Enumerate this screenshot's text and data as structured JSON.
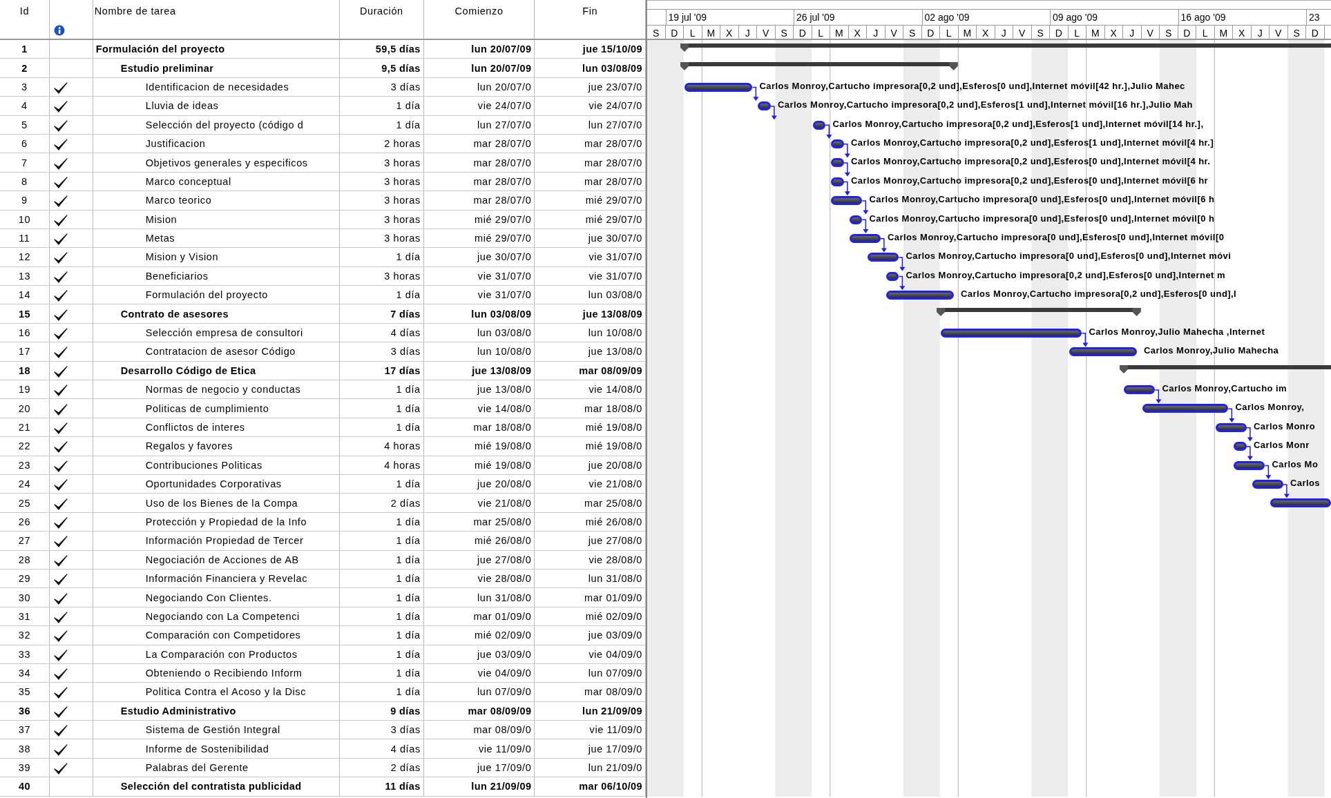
{
  "columns": {
    "id": "Id",
    "name": "Nombre de tarea",
    "duration": "Duración",
    "start": "Comienzo",
    "finish": "Fin"
  },
  "timescale": {
    "weeks": [
      "19 jul '09",
      "26 jul '09",
      "02 ago '09",
      "09 ago '09",
      "16 ago '09",
      "23"
    ],
    "days": [
      "S",
      "D",
      "L",
      "M",
      "X",
      "J",
      "V",
      "S",
      "D",
      "L",
      "M",
      "X",
      "J",
      "V",
      "S",
      "D",
      "L",
      "M",
      "X",
      "J",
      "V",
      "S",
      "D",
      "L",
      "M",
      "X",
      "J",
      "V",
      "S",
      "D",
      "L",
      "M",
      "X",
      "J",
      "V",
      "S",
      "D"
    ]
  },
  "tasks": [
    {
      "id": "1",
      "name": "Formulación del proyecto",
      "kind": "summary",
      "checked": false,
      "duration": "59,5 días",
      "start": "lun 20/07/09",
      "finish": "jue 15/10/09",
      "children": [
        {
          "id": "2",
          "name": "Estudio preliminar",
          "kind": "summary",
          "checked": false,
          "duration": "9,5 días",
          "start": "lun 20/07/09",
          "finish": "lun 03/08/09",
          "children": [
            {
              "id": "3",
              "name": "Identificacion de necesidades",
              "kind": "task",
              "checked": true,
              "duration": "3 días",
              "start": "lun 20/07/0",
              "finish": "jue 23/07/0",
              "resources": "Carlos Monroy,Cartucho impresora[0,2 und],Esferos[0 und],Internet móvil[42 hr.],Julio Mahec"
            },
            {
              "id": "4",
              "name": "Lluvia de ideas",
              "kind": "task",
              "checked": true,
              "duration": "1 día",
              "start": "vie 24/07/0",
              "finish": "vie 24/07/0",
              "resources": "Carlos Monroy,Cartucho impresora[0,2 und],Esferos[1 und],Internet móvil[16 hr.],Julio Mah"
            },
            {
              "id": "5",
              "name": "Selección del proyecto (código d",
              "kind": "task",
              "checked": true,
              "duration": "1 día",
              "start": "lun 27/07/0",
              "finish": "lun 27/07/0",
              "resources": "Carlos Monroy,Cartucho impresora[0,2 und],Esferos[1 und],Internet móvil[14 hr.],"
            },
            {
              "id": "6",
              "name": "Justificacion",
              "kind": "task",
              "checked": true,
              "duration": "2 horas",
              "start": "mar 28/07/0",
              "finish": "mar 28/07/0",
              "resources": "Carlos Monroy,Cartucho impresora[0,2 und],Esferos[1 und],Internet móvil[4 hr.]"
            },
            {
              "id": "7",
              "name": "Objetivos generales y especificos",
              "kind": "task",
              "checked": true,
              "duration": "3 horas",
              "start": "mar 28/07/0",
              "finish": "mar 28/07/0",
              "resources": "Carlos Monroy,Cartucho impresora[0,2 und],Esferos[0 und],Internet móvil[4 hr."
            },
            {
              "id": "8",
              "name": "Marco conceptual",
              "kind": "task",
              "checked": true,
              "duration": "3 horas",
              "start": "mar 28/07/0",
              "finish": "mar 28/07/0",
              "resources": "Carlos Monroy,Cartucho impresora[0,2 und],Esferos[0 und],Internet móvil[6 hr"
            },
            {
              "id": "9",
              "name": "Marco teorico",
              "kind": "task",
              "checked": true,
              "duration": "3 horas",
              "start": "mar 28/07/0",
              "finish": "mié 29/07/0",
              "resources": "Carlos Monroy,Cartucho impresora[0 und],Esferos[0 und],Internet móvil[6 h"
            },
            {
              "id": "10",
              "name": "Mision",
              "kind": "task",
              "checked": true,
              "duration": "3 horas",
              "start": "mié 29/07/0",
              "finish": "mié 29/07/0",
              "resources": "Carlos Monroy,Cartucho impresora[0 und],Esferos[0 und],Internet móvil[0 h"
            },
            {
              "id": "11",
              "name": "Metas",
              "kind": "task",
              "checked": true,
              "duration": "3 horas",
              "start": "mié 29/07/0",
              "finish": "jue 30/07/0",
              "resources": "Carlos Monroy,Cartucho impresora[0 und],Esferos[0 und],Internet móvil[0"
            },
            {
              "id": "12",
              "name": "Mision y Vision",
              "kind": "task",
              "checked": true,
              "duration": "1 día",
              "start": "jue 30/07/0",
              "finish": "vie 31/07/0",
              "resources": "Carlos Monroy,Cartucho impresora[0 und],Esferos[0 und],Internet móvi"
            },
            {
              "id": "13",
              "name": "Beneficiarios",
              "kind": "task",
              "checked": true,
              "duration": "3 horas",
              "start": "vie 31/07/0",
              "finish": "vie 31/07/0",
              "resources": "Carlos Monroy,Cartucho impresora[0,2 und],Esferos[0 und],Internet m"
            },
            {
              "id": "14",
              "name": "Formulación del proyecto",
              "kind": "task",
              "checked": true,
              "duration": "1 día",
              "start": "vie 31/07/0",
              "finish": "lun 03/08/0",
              "resources": "Carlos Monroy,Cartucho impresora[0,2 und],Esferos[0 und],I"
            }
          ]
        },
        {
          "id": "15",
          "name": "Contrato de asesores",
          "kind": "summary",
          "checked": true,
          "duration": "7 días",
          "start": "lun 03/08/09",
          "finish": "jue 13/08/09",
          "children": [
            {
              "id": "16",
              "name": "Selección empresa de consultori",
              "kind": "task",
              "checked": true,
              "duration": "4 días",
              "start": "lun 03/08/0",
              "finish": "lun 10/08/0",
              "resources": "Carlos Monroy,Julio Mahecha ,Internet"
            },
            {
              "id": "17",
              "name": "Contratacion de asesor Código",
              "kind": "task",
              "checked": true,
              "duration": "3 días",
              "start": "lun 10/08/0",
              "finish": "jue 13/08/0",
              "resources": "Carlos Monroy,Julio Mahecha"
            }
          ]
        },
        {
          "id": "18",
          "name": "Desarrollo Código de Etica",
          "kind": "summary",
          "checked": true,
          "duration": "17 días",
          "start": "jue 13/08/09",
          "finish": "mar 08/09/09",
          "children": [
            {
              "id": "19",
              "name": "Normas de negocio y conductas",
              "kind": "task",
              "checked": true,
              "duration": "1 día",
              "start": "jue 13/08/0",
              "finish": "vie 14/08/0",
              "resources": "Carlos Monroy,Cartucho im"
            },
            {
              "id": "20",
              "name": "Politicas de cumplimiento",
              "kind": "task",
              "checked": true,
              "duration": "1 día",
              "start": "vie 14/08/0",
              "finish": "mar 18/08/0",
              "resources": "Carlos Monroy,"
            },
            {
              "id": "21",
              "name": "Conflictos de interes",
              "kind": "task",
              "checked": true,
              "duration": "1 día",
              "start": "mar 18/08/0",
              "finish": "mié 19/08/0",
              "resources": "Carlos Monro"
            },
            {
              "id": "22",
              "name": "Regalos y favores",
              "kind": "task",
              "checked": true,
              "duration": "4 horas",
              "start": "mié 19/08/0",
              "finish": "mié 19/08/0",
              "resources": "Carlos Monr"
            },
            {
              "id": "23",
              "name": "Contribuciones Politicas",
              "kind": "task",
              "checked": true,
              "duration": "4 horas",
              "start": "mié 19/08/0",
              "finish": "jue 20/08/0",
              "resources": "Carlos Mo"
            },
            {
              "id": "24",
              "name": "Oportunidades Corporativas",
              "kind": "task",
              "checked": true,
              "duration": "1 día",
              "start": "jue 20/08/0",
              "finish": "vie 21/08/0",
              "resources": "Carlos"
            },
            {
              "id": "25",
              "name": "Uso de los Bienes de la Compa",
              "kind": "task",
              "checked": true,
              "duration": "2 días",
              "start": "vie 21/08/0",
              "finish": "mar 25/08/0"
            },
            {
              "id": "26",
              "name": "Protección y Propiedad de la Info",
              "kind": "task",
              "checked": true,
              "duration": "1 día",
              "start": "mar 25/08/0",
              "finish": "mié 26/08/0"
            },
            {
              "id": "27",
              "name": "Información Propiedad de Tercer",
              "kind": "task",
              "checked": true,
              "duration": "1 día",
              "start": "mié 26/08/0",
              "finish": "jue 27/08/0"
            },
            {
              "id": "28",
              "name": "Negociación de Acciones de AB",
              "kind": "task",
              "checked": true,
              "duration": "1 día",
              "start": "jue 27/08/0",
              "finish": "vie 28/08/0"
            },
            {
              "id": "29",
              "name": "Información Financiera y Revelac",
              "kind": "task",
              "checked": true,
              "duration": "1 día",
              "start": "vie 28/08/0",
              "finish": "lun 31/08/0"
            },
            {
              "id": "30",
              "name": "Negociando Con Clientes.",
              "kind": "task",
              "checked": true,
              "duration": "1 día",
              "start": "lun 31/08/0",
              "finish": "mar 01/09/0"
            },
            {
              "id": "31",
              "name": "Negociando con La Competenci",
              "kind": "task",
              "checked": true,
              "duration": "1 día",
              "start": "mar 01/09/0",
              "finish": "mié 02/09/0"
            },
            {
              "id": "32",
              "name": "Comparación con Competidores",
              "kind": "task",
              "checked": true,
              "duration": "1 día",
              "start": "mié 02/09/0",
              "finish": "jue 03/09/0"
            },
            {
              "id": "33",
              "name": "La Comparación con Productos",
              "kind": "task",
              "checked": true,
              "duration": "1 día",
              "start": "jue 03/09/0",
              "finish": "vie 04/09/0"
            },
            {
              "id": "34",
              "name": "Obteniendo o Recibiendo Inform",
              "kind": "task",
              "checked": true,
              "duration": "1 día",
              "start": "vie 04/09/0",
              "finish": "lun 07/09/0"
            },
            {
              "id": "35",
              "name": "Politica Contra el Acoso y la Disc",
              "kind": "task",
              "checked": true,
              "duration": "1 día",
              "start": "lun 07/09/0",
              "finish": "mar 08/09/0"
            }
          ]
        },
        {
          "id": "36",
          "name": "Estudio Administrativo",
          "kind": "summary",
          "checked": true,
          "duration": "9 días",
          "start": "mar 08/09/09",
          "finish": "lun 21/09/09",
          "children": [
            {
              "id": "37",
              "name": "Sistema de Gestión Integral",
              "kind": "task",
              "checked": true,
              "duration": "3 días",
              "start": "mar 08/09/0",
              "finish": "vie 11/09/0"
            },
            {
              "id": "38",
              "name": "Informe de Sostenibilidad",
              "kind": "task",
              "checked": true,
              "duration": "4 días",
              "start": "vie 11/09/0",
              "finish": "jue 17/09/0"
            },
            {
              "id": "39",
              "name": "Palabras del Gerente",
              "kind": "task",
              "checked": true,
              "duration": "2 días",
              "start": "jue 17/09/0",
              "finish": "lun 21/09/0"
            }
          ]
        },
        {
          "id": "40",
          "name": "Selección del contratista publicidad",
          "kind": "summary",
          "checked": false,
          "duration": "11 días",
          "start": "lun 21/09/09",
          "finish": "mar 06/10/09"
        }
      ]
    }
  ]
}
